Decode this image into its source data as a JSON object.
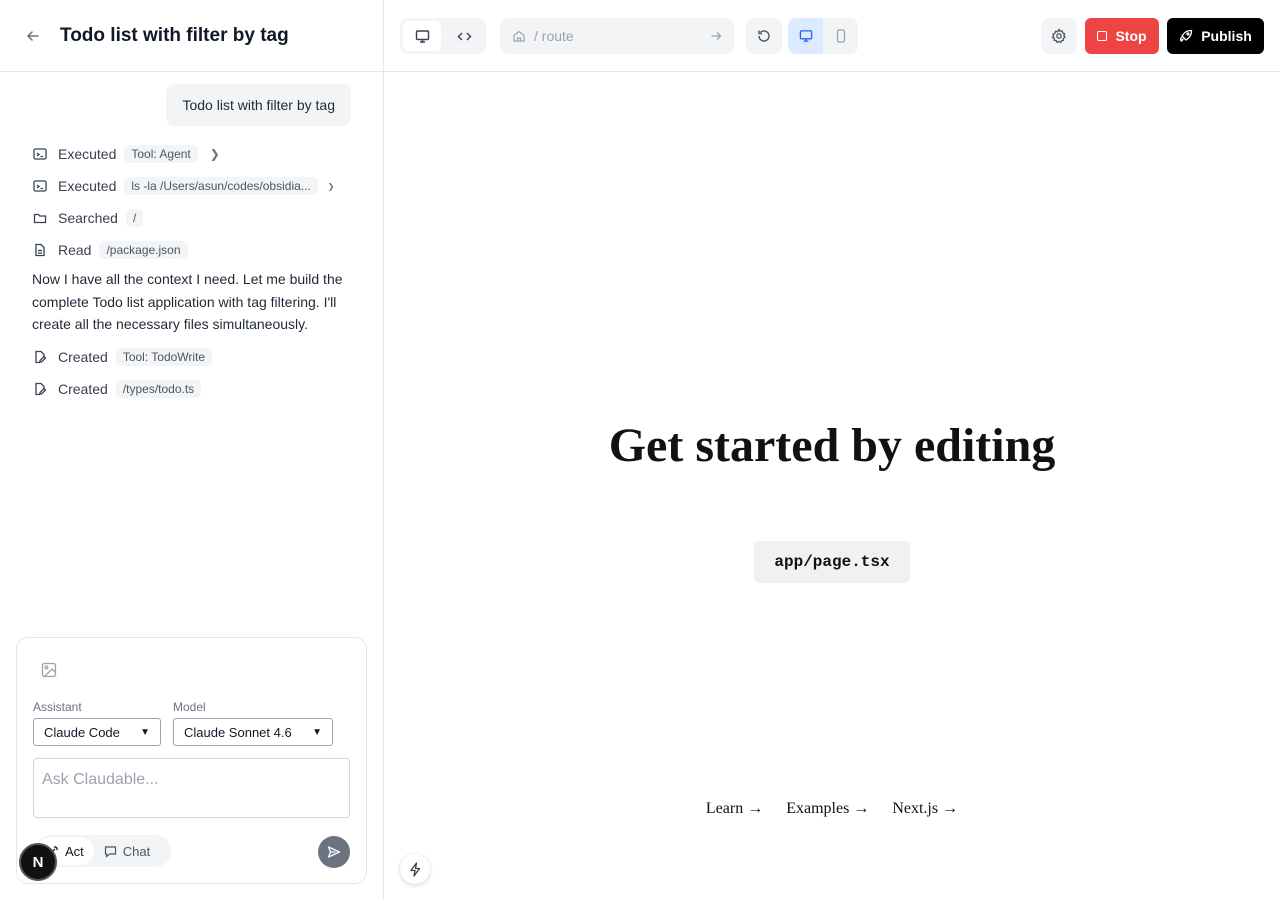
{
  "header": {
    "title": "Todo list with filter by tag"
  },
  "chat": {
    "user_message": "Todo list with filter by tag",
    "log": [
      {
        "icon": "terminal-icon",
        "verb": "Executed",
        "chip": "Tool: Agent"
      },
      {
        "icon": "terminal-icon",
        "verb": "Executed",
        "chip": "ls -la /Users/asun/codes/obsidia..."
      },
      {
        "icon": "folder-icon",
        "verb": "Searched",
        "chip": "/"
      },
      {
        "icon": "file-icon",
        "verb": "Read",
        "chip": "/package.json"
      }
    ],
    "assistant_text": "Now I have all the context I need. Let me build the complete Todo list application with tag filtering. I'll create all the necessary files simultaneously.",
    "log2": [
      {
        "icon": "file-edit-icon",
        "verb": "Created",
        "chip": "Tool: TodoWrite"
      },
      {
        "icon": "file-edit-icon",
        "verb": "Created",
        "chip": "/types/todo.ts"
      }
    ]
  },
  "composer": {
    "assistant_label": "Assistant",
    "assistant_value": "Claude Code",
    "model_label": "Model",
    "model_value": "Claude Sonnet 4.6",
    "placeholder": "Ask Claudable...",
    "mode_act": "Act",
    "mode_chat": "Chat"
  },
  "badge": {
    "letter": "N"
  },
  "toolbar": {
    "url_path": "/ route",
    "stop_label": "Stop",
    "publish_label": "Publish"
  },
  "preview": {
    "heading": "Get started by editing",
    "code": "app/page.tsx",
    "links": [
      "Learn →",
      "Examples →",
      "Next.js →"
    ]
  },
  "colors": {
    "stop": "#ef4444",
    "publish": "#000000",
    "active_device": "#2563eb"
  }
}
